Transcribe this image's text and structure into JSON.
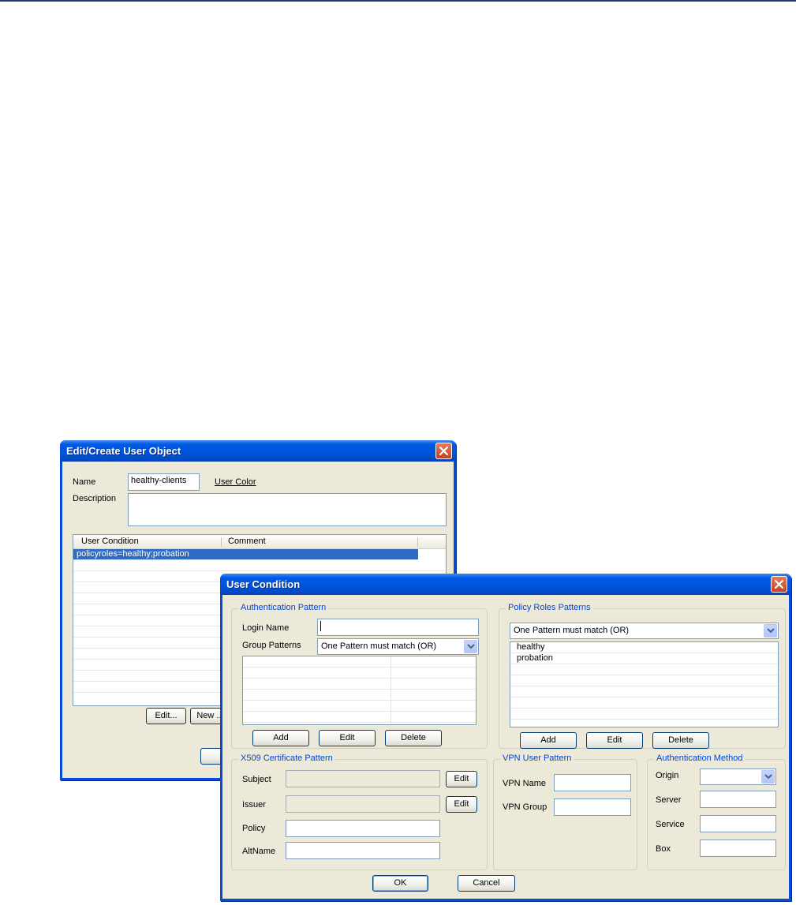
{
  "user_object_dialog": {
    "title": "Edit/Create User Object",
    "name_label": "Name",
    "name_value": "healthy-clients",
    "user_color_link": "User Color",
    "description_label": "Description",
    "description_value": "",
    "columns": [
      "User Condition",
      "Comment"
    ],
    "rows": [
      {
        "condition": "policyroles=healthy;probation",
        "comment": "",
        "selected": true
      }
    ],
    "edit_button": "Edit...",
    "new_button": "New ..."
  },
  "user_condition_dialog": {
    "title": "User Condition",
    "auth_pattern": {
      "title": "Authentication Pattern",
      "login_label": "Login Name",
      "login_value": "",
      "group_label": "Group Patterns",
      "group_select": "One Pattern must match (OR)",
      "add": "Add",
      "edit": "Edit",
      "delete": "Delete"
    },
    "policy_roles": {
      "title": "Policy Roles Patterns",
      "select": "One Pattern must match (OR)",
      "items": [
        "healthy",
        "probation"
      ],
      "add": "Add",
      "edit": "Edit",
      "delete": "Delete"
    },
    "x509": {
      "title": "X509 Certificate Pattern",
      "subject_label": "Subject",
      "subject_value": "",
      "issuer_label": "Issuer",
      "issuer_value": "",
      "policy_label": "Policy",
      "policy_value": "",
      "altname_label": "AltName",
      "altname_value": "",
      "edit_subject": "Edit",
      "edit_issuer": "Edit"
    },
    "vpn": {
      "title": "VPN User Pattern",
      "name_label": "VPN Name",
      "name_value": "",
      "group_label": "VPN Group",
      "group_value": ""
    },
    "auth_method": {
      "title": "Authentication Method",
      "origin_label": "Origin",
      "origin_value": "",
      "server_label": "Server",
      "server_value": "",
      "service_label": "Service",
      "service_value": "",
      "box_label": "Box",
      "box_value": ""
    },
    "ok": "OK",
    "cancel": "Cancel"
  },
  "icons": {
    "close": "close-icon",
    "dropdown": "chevron-down-icon"
  },
  "colors": {
    "titlebar": "#0054dc",
    "window_bg": "#ece9d8",
    "selection": "#316ac5",
    "group_title": "#0046d5"
  }
}
